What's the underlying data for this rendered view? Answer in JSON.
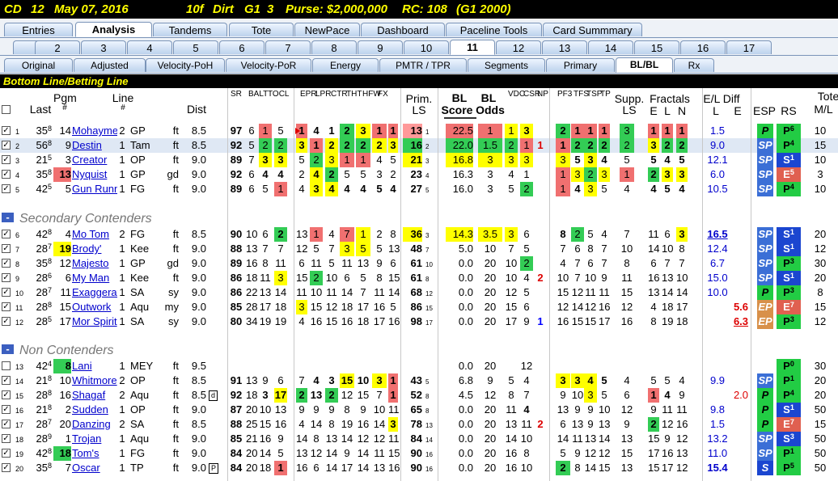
{
  "title": {
    "track": "CD",
    "race": "12",
    "date": "May 07, 2016",
    "dist": "10f",
    "surface": "Dirt",
    "grade": "G1",
    "field": "3",
    "purse": "Purse: $2,000,000",
    "rc": "RC: 108",
    "rc_note": "(G1 2000)"
  },
  "tabs_main": [
    "Entries",
    "Analysis",
    "Tandems",
    "Tote",
    "NewPace",
    "Dashboard",
    "Paceline Tools",
    "Card Summmary"
  ],
  "tabs_main_active": "Analysis",
  "tabs_race": [
    "1",
    "2",
    "3",
    "4",
    "5",
    "6",
    "7",
    "8",
    "9",
    "10",
    "11",
    "12",
    "13",
    "14",
    "15",
    "16",
    "17"
  ],
  "tabs_race_active": "11",
  "tabs_sub": [
    "Original",
    "Adjusted",
    "Velocity-PoH",
    "Velocity-PoR",
    "Energy",
    "PMTR / TPR",
    "Segments",
    "Primary",
    "BL/BL",
    "Rx"
  ],
  "tabs_sub_active": "BL/BL",
  "section_title": "Bottom Line/Betting Line",
  "headers": {
    "last": "Last",
    "pgm": "Pgm",
    "pgm2": "#",
    "line": "Line",
    "line2": "#",
    "dist": "Dist",
    "sr": "SR",
    "balt": "BALT",
    "tocl": "TOCL",
    "epr": "EPR",
    "lpr": "LPR",
    "ctr": "CTR",
    "tht": "THT",
    "hfw": "HFW",
    "fx": "FX",
    "prim": "Prim.",
    "prim2": "LS",
    "bl": "BL",
    "bl2": "Score",
    "blo": "BL",
    "blo2": "Odds",
    "vdc": "VDC",
    "csr": "CSR",
    "np": "NP",
    "pf3": "PF3",
    "tfs": "TFS",
    "tsp": "TSP",
    "tp": "TP",
    "supp": "Supp.",
    "supp2": "LS",
    "fract": "Fractals",
    "fe": "E",
    "fl": "L",
    "fn": "N",
    "eld": "E/L Diff",
    "eld_l": "L",
    "eld_e": "E",
    "esp": "ESP",
    "rs": "RS",
    "tote": "Tote",
    "tote2": "M/L"
  },
  "groups": [
    "Secondary Contenders",
    "Non Contenders"
  ],
  "rows": [
    {
      "i": "1",
      "ck": true,
      "last": "35",
      "lsup": "8",
      "pgm": "14",
      "name": "Mohaymen",
      "line": "2",
      "trk": "GP",
      "cond": "ft",
      "dist": "8.5",
      "sr": "97",
      "b": "6",
      "t": "1",
      "o": "5",
      "e": "1",
      "l": "4",
      "c": "1",
      "th": "2",
      "h": "3",
      "f": "1",
      "x": "1",
      "prim": "13",
      "psub": "1",
      "bls": "22.5",
      "blo": "1",
      "vdc": "1",
      "csr": "3",
      "np": "",
      "pf": "2",
      "tf": "1",
      "ts": "1",
      "tp": "1",
      "supp": "3",
      "fe": "1",
      "fl": "1",
      "fn": "1",
      "eL": "1.5",
      "eE": "",
      "esp": "P",
      "rs": "P",
      "rsup": "6",
      "tote": "10"
    },
    {
      "i": "2",
      "ck": true,
      "last": "56",
      "lsup": "8",
      "pgm": "9",
      "name": "Destin",
      "line": "1",
      "trk": "Tam",
      "cond": "ft",
      "dist": "8.5",
      "sr": "92",
      "b": "5",
      "t": "2",
      "o": "2",
      "e": "3",
      "l": "1",
      "c": "2",
      "th": "2",
      "h": "2",
      "f": "2",
      "x": "3",
      "prim": "16",
      "psub": "2",
      "bls": "22.0",
      "blo": "1.5",
      "vdc": "2",
      "csr": "1",
      "np": "1",
      "pf": "1",
      "tf": "2",
      "ts": "2",
      "tp": "2",
      "supp": "2",
      "fe": "3",
      "fl": "2",
      "fn": "2",
      "eL": "9.0",
      "eE": "",
      "esp": "SP",
      "rs": "P",
      "rsup": "4",
      "tote": "15"
    },
    {
      "i": "3",
      "ck": true,
      "last": "21",
      "lsup": "5",
      "pgm": "3",
      "name": "Creator",
      "line": "1",
      "trk": "OP",
      "cond": "ft",
      "dist": "9.0",
      "sr": "89",
      "b": "7",
      "t": "3",
      "o": "3",
      "e": "5",
      "l": "2",
      "c": "3",
      "th": "1",
      "h": "1",
      "f": "4",
      "x": "5",
      "prim": "21",
      "psub": "3",
      "bls": "16.8",
      "blo": "3",
      "vdc": "3",
      "csr": "3",
      "np": "",
      "pf": "3",
      "tf": "5",
      "ts": "3",
      "tp": "4",
      "supp": "5",
      "fe": "5",
      "fl": "4",
      "fn": "5",
      "eL": "12.1",
      "eE": "",
      "esp": "SP",
      "rs": "S",
      "rsup": "1",
      "tote": "10"
    },
    {
      "i": "4",
      "ck": true,
      "last": "35",
      "lsup": "8",
      "pgm": "13",
      "name": "Nyquist",
      "line": "1",
      "trk": "GP",
      "cond": "gd",
      "dist": "9.0",
      "sr": "92",
      "b": "6",
      "t": "4",
      "o": "4",
      "e": "2",
      "l": "4",
      "c": "2",
      "th": "5",
      "h": "5",
      "f": "3",
      "x": "2",
      "prim": "23",
      "psub": "4",
      "bls": "16.3",
      "blo": "3",
      "vdc": "4",
      "csr": "1",
      "np": "",
      "pf": "1",
      "tf": "3",
      "ts": "2",
      "tp": "3",
      "supp": "1",
      "fe": "2",
      "fl": "3",
      "fn": "3",
      "eL": "6.0",
      "eE": "",
      "esp": "SP",
      "rs": "E",
      "rsup": "5",
      "tote": "3"
    },
    {
      "i": "5",
      "ck": true,
      "last": "42",
      "lsup": "5",
      "pgm": "5",
      "name": "Gun Runner",
      "line": "1",
      "trk": "FG",
      "cond": "ft",
      "dist": "9.0",
      "sr": "89",
      "b": "6",
      "t": "5",
      "o": "1",
      "e": "4",
      "l": "3",
      "c": "4",
      "th": "4",
      "h": "4",
      "f": "5",
      "x": "4",
      "prim": "27",
      "psub": "5",
      "bls": "16.0",
      "blo": "3",
      "vdc": "5",
      "csr": "2",
      "np": "",
      "pf": "1",
      "tf": "4",
      "ts": "3",
      "tp": "5",
      "supp": "4",
      "fe": "4",
      "fl": "5",
      "fn": "4",
      "eL": "10.5",
      "eE": "",
      "esp": "SP",
      "rs": "P",
      "rsup": "4",
      "tote": "10"
    },
    {
      "i": "6",
      "ck": true,
      "last": "42",
      "lsup": "8",
      "pgm": "4",
      "name": "Mo Tom",
      "line": "2",
      "trk": "FG",
      "cond": "ft",
      "dist": "8.5",
      "sr": "90",
      "b": "10",
      "t": "6",
      "o": "2",
      "e": "13",
      "l": "1",
      "c": "4",
      "th": "7",
      "h": "1",
      "f": "2",
      "x": "8",
      "prim": "36",
      "psub": "3",
      "bls": "14.3",
      "blo": "3.5",
      "vdc": "3",
      "csr": "6",
      "np": "",
      "pf": "8",
      "tf": "2",
      "ts": "5",
      "tp": "4",
      "supp": "7",
      "fe": "11",
      "fl": "6",
      "fn": "3",
      "eL": "16.5",
      "eE": "",
      "esp": "SP",
      "rs": "S",
      "rsup": "1",
      "tote": "20"
    },
    {
      "i": "7",
      "ck": true,
      "last": "28",
      "lsup": "7",
      "pgm": "19",
      "name": "Brody'",
      "line": "1",
      "trk": "Kee",
      "cond": "ft",
      "dist": "9.0",
      "sr": "88",
      "b": "13",
      "t": "7",
      "o": "7",
      "e": "12",
      "l": "5",
      "c": "7",
      "th": "3",
      "h": "5",
      "f": "5",
      "x": "13",
      "prim": "48",
      "psub": "7",
      "bls": "5.0",
      "blo": "10",
      "vdc": "7",
      "csr": "5",
      "np": "",
      "pf": "7",
      "tf": "6",
      "ts": "8",
      "tp": "7",
      "supp": "10",
      "fe": "14",
      "fl": "10",
      "fn": "8",
      "eL": "12.4",
      "eE": "",
      "esp": "SP",
      "rs": "S",
      "rsup": "1",
      "tote": "12"
    },
    {
      "i": "8",
      "ck": true,
      "last": "35",
      "lsup": "8",
      "pgm": "12",
      "name": "Majesto",
      "line": "1",
      "trk": "GP",
      "cond": "gd",
      "dist": "9.0",
      "sr": "89",
      "b": "16",
      "t": "8",
      "o": "11",
      "e": "6",
      "l": "11",
      "c": "5",
      "th": "11",
      "h": "13",
      "f": "9",
      "x": "6",
      "prim": "61",
      "psub": "10",
      "bls": "0.0",
      "blo": "20",
      "vdc": "10",
      "csr": "2",
      "np": "",
      "pf": "4",
      "tf": "7",
      "ts": "6",
      "tp": "7",
      "supp": "8",
      "fe": "6",
      "fl": "7",
      "fn": "7",
      "eL": "6.7",
      "eE": "",
      "esp": "SP",
      "rs": "P",
      "rsup": "3",
      "tote": "30"
    },
    {
      "i": "9",
      "ck": true,
      "last": "28",
      "lsup": "6",
      "pgm": "6",
      "name": "My Man",
      "line": "1",
      "trk": "Kee",
      "cond": "ft",
      "dist": "9.0",
      "sr": "86",
      "b": "18",
      "t": "11",
      "o": "3",
      "e": "15",
      "l": "2",
      "c": "10",
      "th": "6",
      "h": "5",
      "f": "8",
      "x": "15",
      "prim": "61",
      "psub": "8",
      "bls": "0.0",
      "blo": "20",
      "vdc": "10",
      "csr": "4",
      "np": "2",
      "pf": "10",
      "tf": "7",
      "ts": "10",
      "tp": "9",
      "supp": "11",
      "fe": "16",
      "fl": "13",
      "fn": "10",
      "eL": "15.0",
      "eE": "",
      "esp": "SP",
      "rs": "S",
      "rsup": "1",
      "tote": "20"
    },
    {
      "i": "10",
      "ck": true,
      "last": "28",
      "lsup": "7",
      "pgm": "11",
      "name": "Exaggerator",
      "line": "1",
      "trk": "SA",
      "cond": "sy",
      "dist": "9.0",
      "sr": "86",
      "b": "22",
      "t": "13",
      "o": "14",
      "e": "11",
      "l": "10",
      "c": "11",
      "th": "14",
      "h": "7",
      "f": "11",
      "x": "14",
      "prim": "68",
      "psub": "12",
      "bls": "0.0",
      "blo": "20",
      "vdc": "12",
      "csr": "5",
      "np": "",
      "pf": "15",
      "tf": "12",
      "ts": "11",
      "tp": "11",
      "supp": "15",
      "fe": "13",
      "fl": "14",
      "fn": "14",
      "eL": "10.0",
      "eE": "",
      "esp": "P",
      "rs": "P",
      "rsup": "3",
      "tote": "8"
    },
    {
      "i": "11",
      "ck": true,
      "last": "28",
      "lsup": "8",
      "pgm": "15",
      "name": "Outwork",
      "line": "1",
      "trk": "Aqu",
      "cond": "my",
      "dist": "9.0",
      "sr": "85",
      "b": "28",
      "t": "17",
      "o": "18",
      "e": "3",
      "l": "15",
      "c": "12",
      "th": "18",
      "h": "17",
      "f": "16",
      "x": "5",
      "prim": "86",
      "psub": "15",
      "bls": "0.0",
      "blo": "20",
      "vdc": "15",
      "csr": "6",
      "np": "",
      "pf": "12",
      "tf": "14",
      "ts": "12",
      "tp": "16",
      "supp": "12",
      "fe": "4",
      "fl": "18",
      "fn": "17",
      "eL": "",
      "eE": "5.6",
      "esp": "EP",
      "rs": "E",
      "rsup": "7",
      "tote": "15"
    },
    {
      "i": "12",
      "ck": true,
      "last": "28",
      "lsup": "5",
      "pgm": "17",
      "name": "Mor Spirit",
      "line": "1",
      "trk": "SA",
      "cond": "sy",
      "dist": "9.0",
      "sr": "80",
      "b": "34",
      "t": "19",
      "o": "19",
      "e": "4",
      "l": "16",
      "c": "15",
      "th": "16",
      "h": "18",
      "f": "17",
      "x": "16",
      "prim": "98",
      "psub": "17",
      "bls": "0.0",
      "blo": "20",
      "vdc": "17",
      "csr": "9",
      "np": "1",
      "pf": "16",
      "tf": "15",
      "ts": "15",
      "tp": "17",
      "supp": "16",
      "fe": "8",
      "fl": "19",
      "fn": "18",
      "eL": "",
      "eE": "6.3",
      "esp": "EP",
      "rs": "P",
      "rsup": "3",
      "tote": "12"
    },
    {
      "i": "13",
      "ck": false,
      "last": "42",
      "lsup": "4",
      "pgm": "8",
      "name": "Lani",
      "line": "1",
      "trk": "MEY",
      "cond": "ft",
      "dist": "9.5",
      "sr": "",
      "b": "",
      "t": "",
      "o": "",
      "e": "",
      "l": "",
      "c": "",
      "th": "",
      "h": "",
      "f": "",
      "x": "",
      "prim": "",
      "psub": "",
      "bls": "0.0",
      "blo": "20",
      "vdc": "",
      "csr": "12",
      "np": "",
      "pf": "",
      "tf": "",
      "ts": "",
      "tp": "",
      "supp": "",
      "fe": "",
      "fl": "",
      "fn": "",
      "eL": "",
      "eE": "",
      "esp": "",
      "rs": "P",
      "rsup": "0",
      "tote": "30"
    },
    {
      "i": "14",
      "ck": true,
      "last": "21",
      "lsup": "8",
      "pgm": "10",
      "name": "Whitmore",
      "line": "2",
      "trk": "OP",
      "cond": "ft",
      "dist": "8.5",
      "sr": "91",
      "b": "13",
      "t": "9",
      "o": "6",
      "e": "7",
      "l": "4",
      "c": "3",
      "th": "15",
      "h": "10",
      "f": "3",
      "x": "1",
      "prim": "43",
      "psub": "5",
      "bls": "6.8",
      "blo": "9",
      "vdc": "5",
      "csr": "4",
      "np": "",
      "pf": "3",
      "tf": "3",
      "ts": "4",
      "tp": "5",
      "supp": "4",
      "fe": "5",
      "fl": "5",
      "fn": "4",
      "eL": "9.9",
      "eE": "",
      "esp": "SP",
      "rs": "P",
      "rsup": "1",
      "tote": "20"
    },
    {
      "i": "15",
      "ck": true,
      "last": "28",
      "lsup": "8",
      "pgm": "16",
      "name": "Shagaf",
      "line": "2",
      "trk": "Aqu",
      "cond": "ft",
      "dist": "8.5",
      "sr": "92",
      "b": "18",
      "t": "3",
      "o": "17",
      "e": "2",
      "l": "13",
      "c": "2",
      "th": "12",
      "h": "15",
      "f": "7",
      "x": "1",
      "prim": "52",
      "psub": "8",
      "bls": "4.5",
      "blo": "12",
      "vdc": "8",
      "csr": "7",
      "np": "",
      "pf": "9",
      "tf": "10",
      "ts": "3",
      "tp": "5",
      "supp": "6",
      "fe": "1",
      "fl": "4",
      "fn": "9",
      "eL": "",
      "eE": "2.0",
      "esp": "P",
      "rs": "P",
      "rsup": "4",
      "tote": "20"
    },
    {
      "i": "16",
      "ck": true,
      "last": "21",
      "lsup": "8",
      "pgm": "2",
      "name": "Sudden",
      "line": "1",
      "trk": "OP",
      "cond": "ft",
      "dist": "9.0",
      "sr": "87",
      "b": "20",
      "t": "10",
      "o": "13",
      "e": "9",
      "l": "9",
      "c": "9",
      "th": "8",
      "h": "9",
      "f": "10",
      "x": "11",
      "prim": "65",
      "psub": "8",
      "bls": "0.0",
      "blo": "20",
      "vdc": "11",
      "csr": "4",
      "np": "",
      "pf": "13",
      "tf": "9",
      "ts": "9",
      "tp": "10",
      "supp": "12",
      "fe": "9",
      "fl": "11",
      "fn": "11",
      "eL": "9.8",
      "eE": "",
      "esp": "P",
      "rs": "S",
      "rsup": "1",
      "tote": "50"
    },
    {
      "i": "17",
      "ck": true,
      "last": "28",
      "lsup": "7",
      "pgm": "20",
      "name": "Danzing",
      "line": "2",
      "trk": "SA",
      "cond": "ft",
      "dist": "8.5",
      "sr": "88",
      "b": "25",
      "t": "15",
      "o": "16",
      "e": "4",
      "l": "14",
      "c": "8",
      "th": "19",
      "h": "16",
      "f": "14",
      "x": "3",
      "prim": "78",
      "psub": "13",
      "bls": "0.0",
      "blo": "20",
      "vdc": "13",
      "csr": "11",
      "np": "2",
      "pf": "6",
      "tf": "13",
      "ts": "9",
      "tp": "13",
      "supp": "9",
      "fe": "2",
      "fl": "12",
      "fn": "16",
      "eL": "1.5",
      "eE": "",
      "esp": "P",
      "rs": "E",
      "rsup": "7",
      "tote": "15"
    },
    {
      "i": "18",
      "ck": true,
      "last": "28",
      "lsup": "9",
      "pgm": "1",
      "name": "Trojan",
      "line": "1",
      "trk": "Aqu",
      "cond": "ft",
      "dist": "9.0",
      "sr": "85",
      "b": "21",
      "t": "16",
      "o": "9",
      "e": "14",
      "l": "8",
      "c": "13",
      "th": "14",
      "h": "12",
      "f": "12",
      "x": "11",
      "prim": "84",
      "psub": "14",
      "bls": "0.0",
      "blo": "20",
      "vdc": "14",
      "csr": "10",
      "np": "",
      "pf": "14",
      "tf": "11",
      "ts": "13",
      "tp": "14",
      "supp": "13",
      "fe": "15",
      "fl": "9",
      "fn": "12",
      "eL": "13.2",
      "eE": "",
      "esp": "SP",
      "rs": "S",
      "rsup": "3",
      "tote": "50"
    },
    {
      "i": "19",
      "ck": true,
      "last": "42",
      "lsup": "8",
      "pgm": "18",
      "name": "Tom's",
      "line": "1",
      "trk": "FG",
      "cond": "ft",
      "dist": "9.0",
      "sr": "84",
      "b": "20",
      "t": "14",
      "o": "5",
      "e": "13",
      "l": "12",
      "c": "14",
      "th": "9",
      "h": "14",
      "f": "11",
      "x": "15",
      "prim": "90",
      "psub": "16",
      "bls": "0.0",
      "blo": "20",
      "vdc": "16",
      "csr": "8",
      "np": "",
      "pf": "5",
      "tf": "9",
      "ts": "12",
      "tp": "12",
      "supp": "15",
      "fe": "17",
      "fl": "16",
      "fn": "13",
      "eL": "11.0",
      "eE": "",
      "esp": "SP",
      "rs": "P",
      "rsup": "1",
      "tote": "50"
    },
    {
      "i": "20",
      "ck": true,
      "last": "35",
      "lsup": "8",
      "pgm": "7",
      "name": "Oscar",
      "line": "1",
      "trk": "TP",
      "cond": "ft",
      "dist": "9.0",
      "sr": "84",
      "b": "20",
      "t": "18",
      "o": "1",
      "e": "16",
      "l": "6",
      "c": "14",
      "th": "17",
      "h": "14",
      "f": "13",
      "x": "16",
      "prim": "90",
      "psub": "16",
      "bls": "0.0",
      "blo": "20",
      "vdc": "16",
      "csr": "10",
      "np": "",
      "pf": "2",
      "tf": "8",
      "ts": "14",
      "tp": "15",
      "supp": "13",
      "fe": "15",
      "fl": "17",
      "fn": "12",
      "eL": "15.4",
      "eE": "",
      "esp": "S",
      "rs": "P",
      "rsup": "5",
      "tote": "50"
    }
  ]
}
